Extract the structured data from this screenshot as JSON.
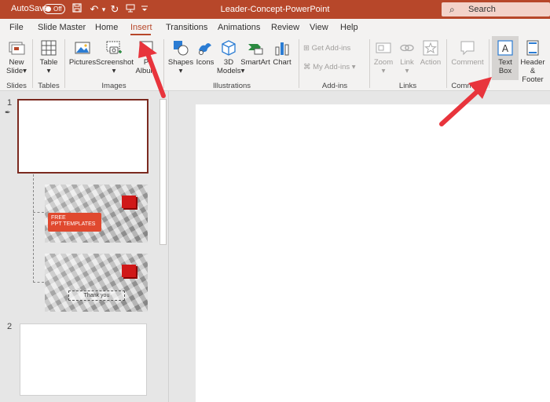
{
  "titlebar": {
    "autosave_label": "AutoSave",
    "autosave_state": "Off",
    "doc_title": "Leader-Concept-PowerPoint",
    "search_placeholder": "Search"
  },
  "tabs": [
    "File",
    "Slide Master",
    "Home",
    "Insert",
    "Transitions",
    "Animations",
    "Review",
    "View",
    "Help"
  ],
  "active_tab": "Insert",
  "ribbon": {
    "new_slide": [
      "New",
      "Slide"
    ],
    "table": "Table",
    "pictures": "Pictures",
    "screenshot": "Screenshot",
    "photo_album": [
      "P",
      "Album"
    ],
    "shapes": "Shapes",
    "icons": "Icons",
    "models_3d": [
      "3D",
      "Models"
    ],
    "smartart": "SmartArt",
    "chart": "Chart",
    "get_addins": "Get Add-ins",
    "my_addins": "My Add-ins",
    "zoom": "Zoom",
    "link": "Link",
    "action": "Action",
    "comment": "Comment",
    "text_box": [
      "Text",
      "Box"
    ],
    "header_footer": [
      "Header",
      "& Footer"
    ],
    "groups": {
      "slides": "Slides",
      "tables": "Tables",
      "images": "Images",
      "illustrations": "Illustrations",
      "addins": "Add-ins",
      "links": "Links",
      "comments": "Comment"
    }
  },
  "slides": {
    "slide1_num": "1",
    "slide2_num": "2",
    "layout1_banner": [
      "FREE",
      "PPT TEMPLATES"
    ],
    "layout2_text": "Thank you"
  },
  "colors": {
    "accent": "#b7472a",
    "selection_border": "#7b2a20",
    "arrow": "#e8343c"
  }
}
